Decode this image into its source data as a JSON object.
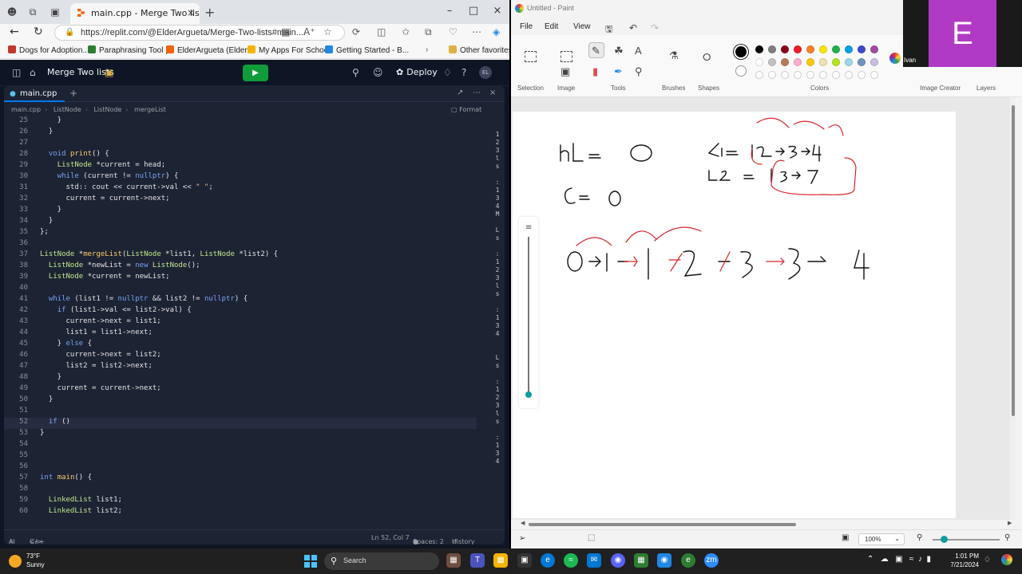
{
  "browser": {
    "tab_title": "main.cpp - Merge Two lists - Repl",
    "url": "https://replit.com/@ElderArgueta/Merge-Two-lists#main....",
    "bookmarks": [
      "Dogs for Adoption...",
      "Paraphrasing Tool |...",
      "ElderArgueta (Elder...",
      "My Apps For School",
      "Getting Started - B...",
      "Other favorites"
    ]
  },
  "replit": {
    "project_title": "Merge Two lists",
    "deploy_label": "Deploy",
    "avatar_initials": "EL",
    "file_tab": "main.cpp",
    "breadcrumb": [
      "main.cpp",
      "ListNode",
      "ListNode",
      "mergeList"
    ],
    "format_label": "Format",
    "code_lines": [
      {
        "n": "25",
        "t": "    }"
      },
      {
        "n": "26",
        "t": "  }"
      },
      {
        "n": "27",
        "t": ""
      },
      {
        "n": "28",
        "t": "  void print() {"
      },
      {
        "n": "29",
        "t": "    ListNode *current = head;"
      },
      {
        "n": "30",
        "t": "    while (current != nullptr) {"
      },
      {
        "n": "31",
        "t": "      std:: cout << current->val << \" \";"
      },
      {
        "n": "32",
        "t": "      current = current->next;"
      },
      {
        "n": "33",
        "t": "    }"
      },
      {
        "n": "34",
        "t": "  }"
      },
      {
        "n": "35",
        "t": "};"
      },
      {
        "n": "36",
        "t": ""
      },
      {
        "n": "37",
        "t": "ListNode *mergeList(ListNode *list1, ListNode *list2) {"
      },
      {
        "n": "38",
        "t": "  ListNode *newList = new ListNode();"
      },
      {
        "n": "39",
        "t": "  ListNode *current = newList;"
      },
      {
        "n": "40",
        "t": ""
      },
      {
        "n": "41",
        "t": "  while (list1 != nullptr && list2 != nullptr) {"
      },
      {
        "n": "42",
        "t": "    if (list1->val <= list2->val) {"
      },
      {
        "n": "43",
        "t": "      current->next = list1;"
      },
      {
        "n": "44",
        "t": "      list1 = list1->next;"
      },
      {
        "n": "45",
        "t": "    } else {"
      },
      {
        "n": "46",
        "t": "      current->next = list2;"
      },
      {
        "n": "47",
        "t": "      list2 = list2->next;"
      },
      {
        "n": "48",
        "t": "    }"
      },
      {
        "n": "49",
        "t": "    current = current->next;"
      },
      {
        "n": "50",
        "t": "  }"
      },
      {
        "n": "51",
        "t": ""
      },
      {
        "n": "52",
        "t": "  if ()"
      },
      {
        "n": "53",
        "t": "}"
      },
      {
        "n": "54",
        "t": ""
      },
      {
        "n": "55",
        "t": ""
      },
      {
        "n": "56",
        "t": ""
      },
      {
        "n": "57",
        "t": "int main() {"
      },
      {
        "n": "58",
        "t": ""
      },
      {
        "n": "59",
        "t": "  LinkedList list1;"
      },
      {
        "n": "60",
        "t": "  LinkedList list2;"
      }
    ],
    "current_line": "52",
    "console_strip": "1\n2\n3\nl\ns\n\n:\n1\n3\n4\nM\n\nL\ns\n\n:\n1\n2\n3\nl\ns\n\n:\n1\n3\n4\n\n\nL\ns\n\n:\n1\n2\n3\nl\ns\n\n:\n1\n3\n4",
    "status": {
      "ai": "AI",
      "lang": "C++",
      "position": "Ln 52, Col 7",
      "spaces": "Spaces: 2",
      "history": "History"
    }
  },
  "paint": {
    "window_title": "Untitled - Paint",
    "menu": [
      "File",
      "Edit",
      "View"
    ],
    "groups": [
      "Selection",
      "Image",
      "Tools",
      "Brushes",
      "Shapes",
      "Colors",
      "Image Creator",
      "Layers"
    ],
    "user_label": "Ivan",
    "zoom": "100%",
    "palette_row1": [
      "#000000",
      "#7f7f7f",
      "#880015",
      "#ed1c24",
      "#ff7f27",
      "#ffe600",
      "#22b14c",
      "#00a2e8",
      "#3f48cc",
      "#a349a4"
    ],
    "palette_row2": [
      "#ffffff",
      "#c3c3c3",
      "#b97a57",
      "#ffaec9",
      "#ffc90e",
      "#efe4b0",
      "#b5e61d",
      "#99d9ea",
      "#7092be",
      "#c8bfe7"
    ]
  },
  "webcam": {
    "initial": "E",
    "name": "Ivan"
  },
  "taskbar": {
    "temp": "73°F",
    "condition": "Sunny",
    "search_placeholder": "Search",
    "time": "1:01 PM",
    "date": "7/21/2024"
  }
}
